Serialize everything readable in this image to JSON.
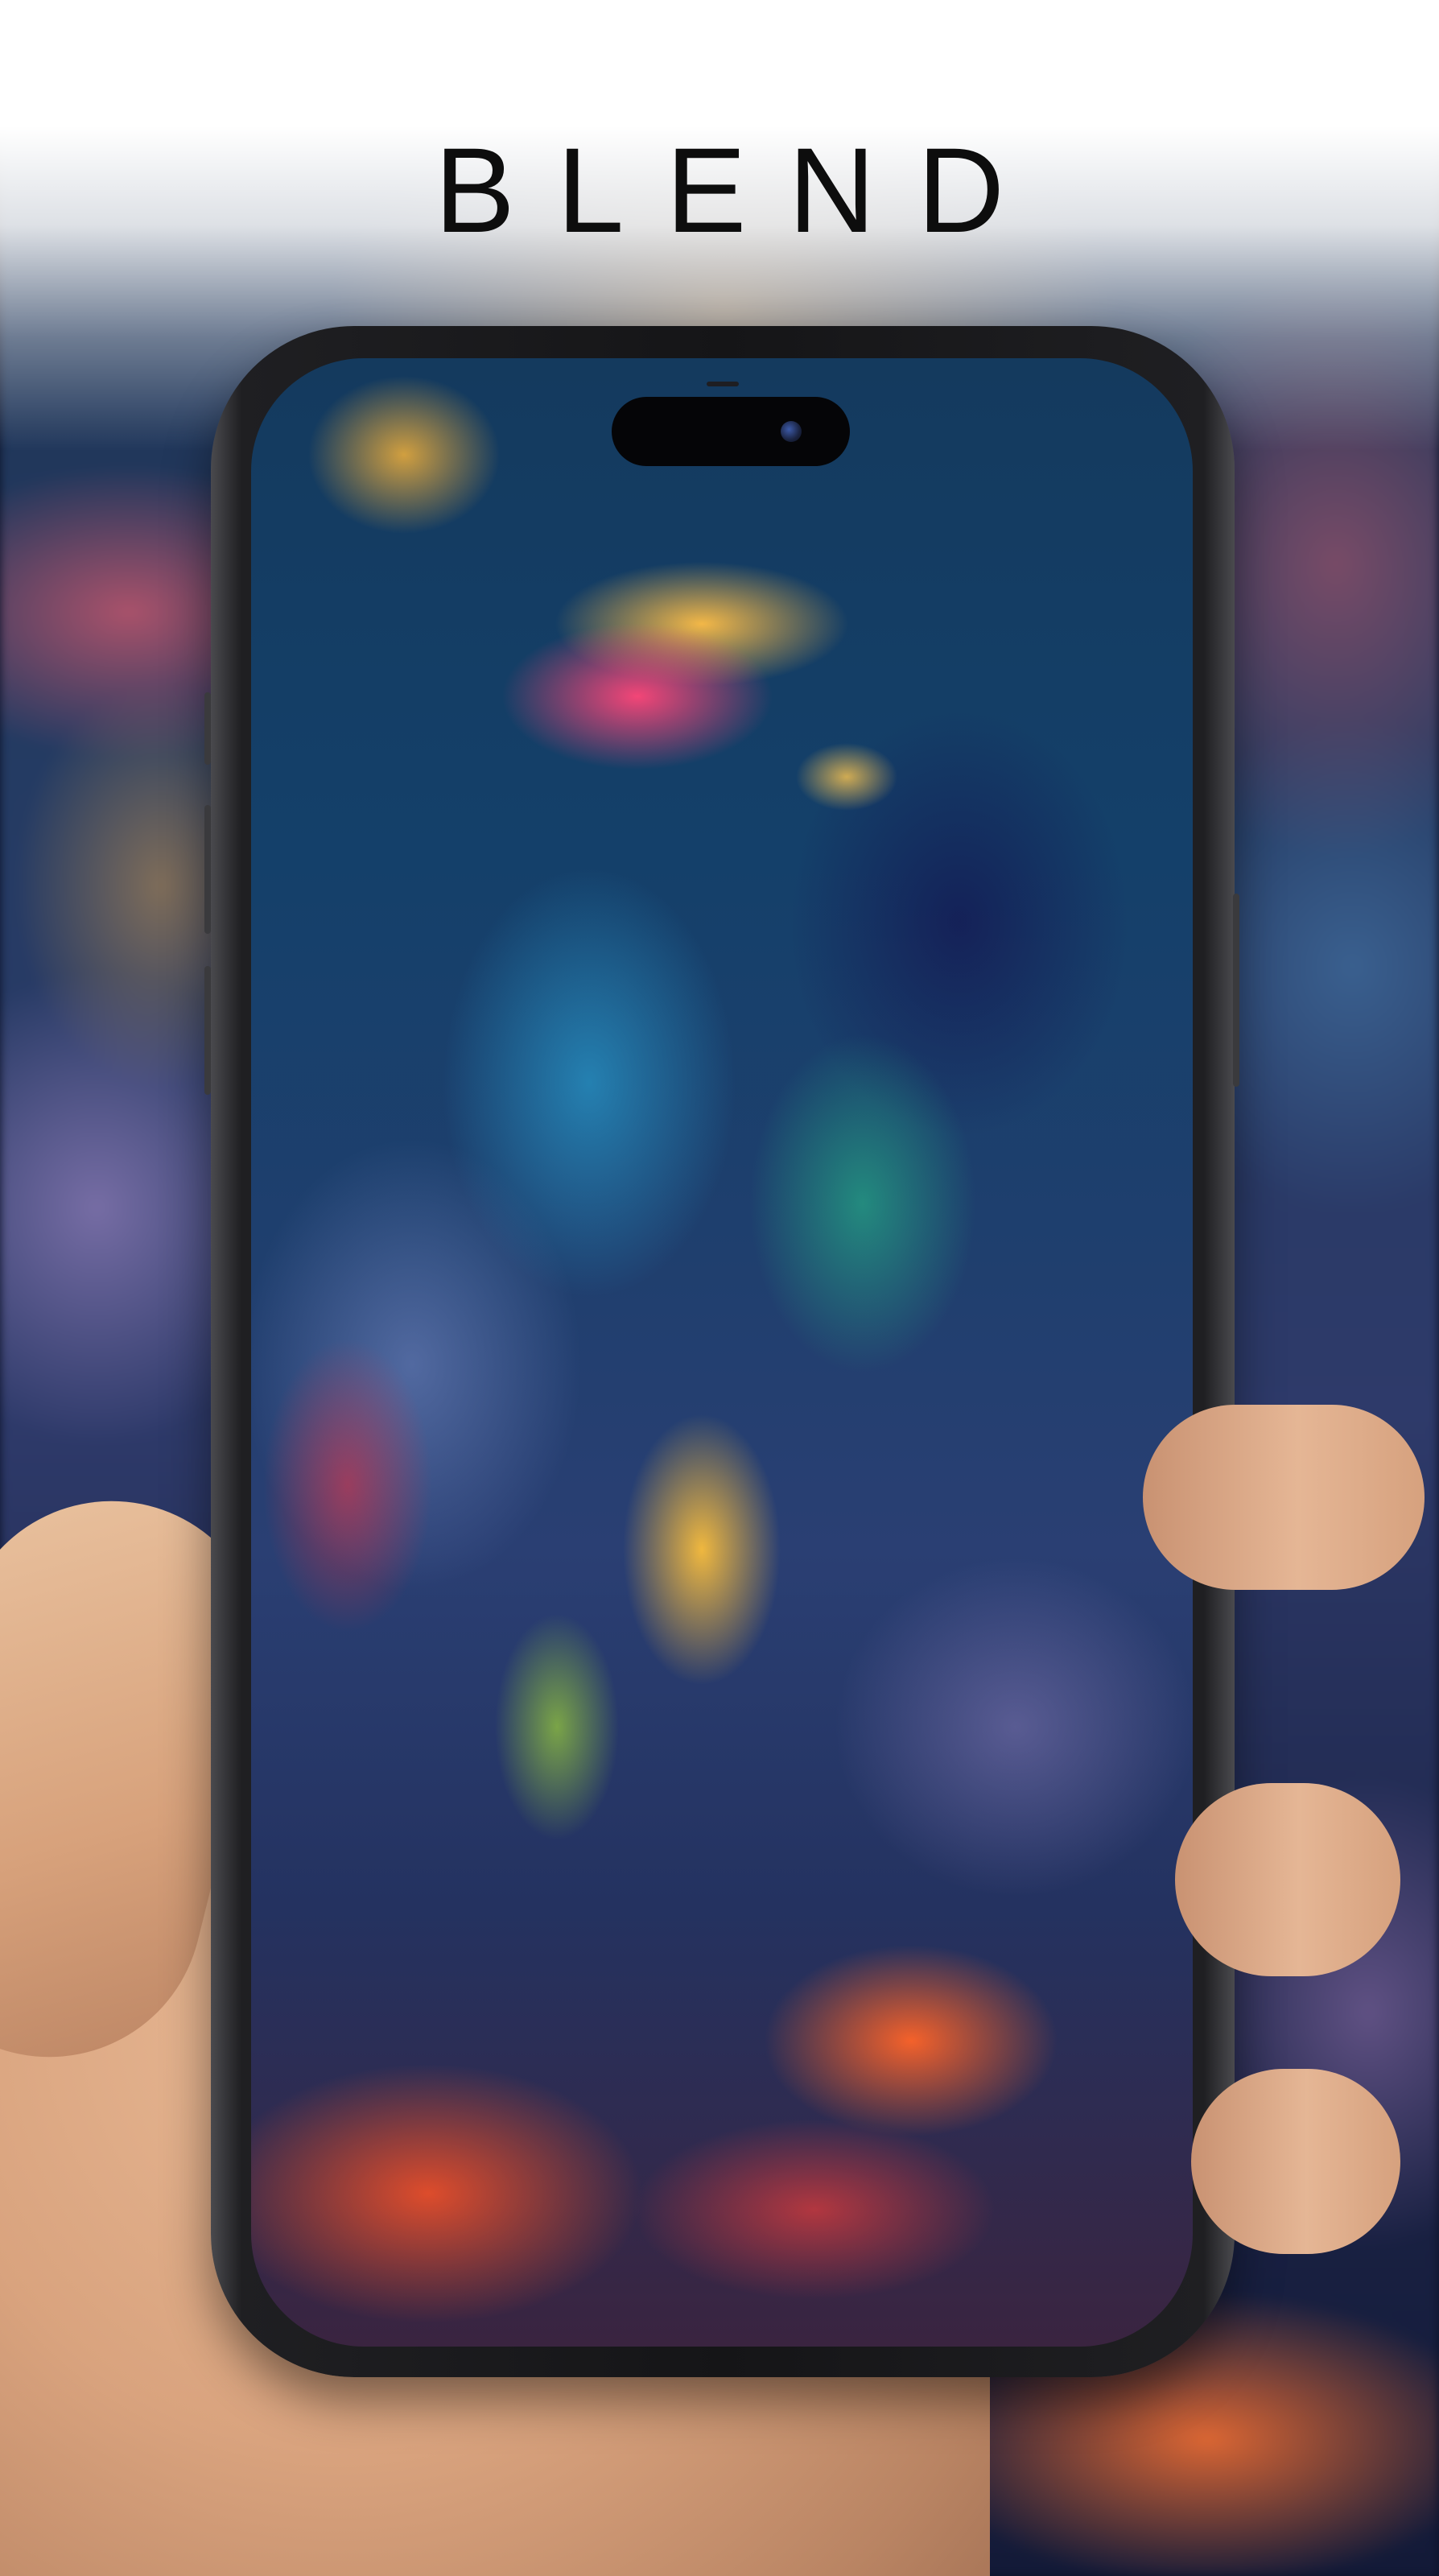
{
  "header": {
    "title": "BLEND"
  },
  "colors": {
    "title": "#0d0d0d",
    "background_top": "#ffffff",
    "phone_frame": "#151517"
  }
}
